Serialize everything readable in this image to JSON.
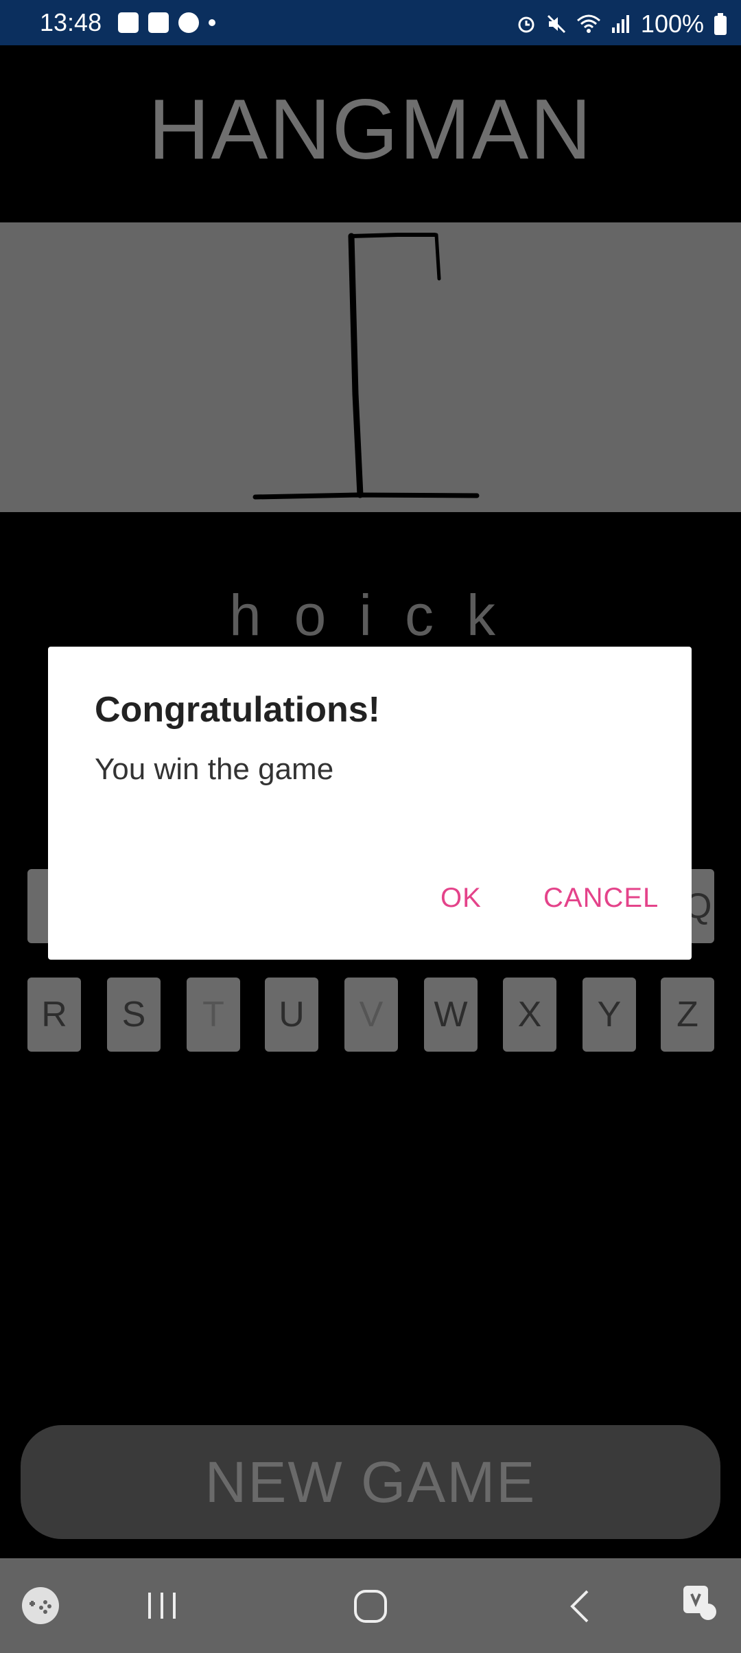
{
  "status_bar": {
    "time": "13:48",
    "battery": "100%"
  },
  "title": "HANGMAN",
  "word": "hoick",
  "keyboard": {
    "partial_right": "Q",
    "row2": [
      {
        "letter": "R",
        "used": false
      },
      {
        "letter": "S",
        "used": false
      },
      {
        "letter": "T",
        "used": true
      },
      {
        "letter": "U",
        "used": false
      },
      {
        "letter": "V",
        "used": true
      },
      {
        "letter": "W",
        "used": false
      },
      {
        "letter": "X",
        "used": false
      },
      {
        "letter": "Y",
        "used": false
      },
      {
        "letter": "Z",
        "used": false
      }
    ]
  },
  "new_game_label": "NEW GAME",
  "dialog": {
    "title": "Congratulations!",
    "message": "You win the game",
    "ok_label": "OK",
    "cancel_label": "CANCEL"
  },
  "colors": {
    "status_bar_bg": "#0b2f5e",
    "dialog_button": "#e4438a",
    "panel_gray": "#666666"
  }
}
